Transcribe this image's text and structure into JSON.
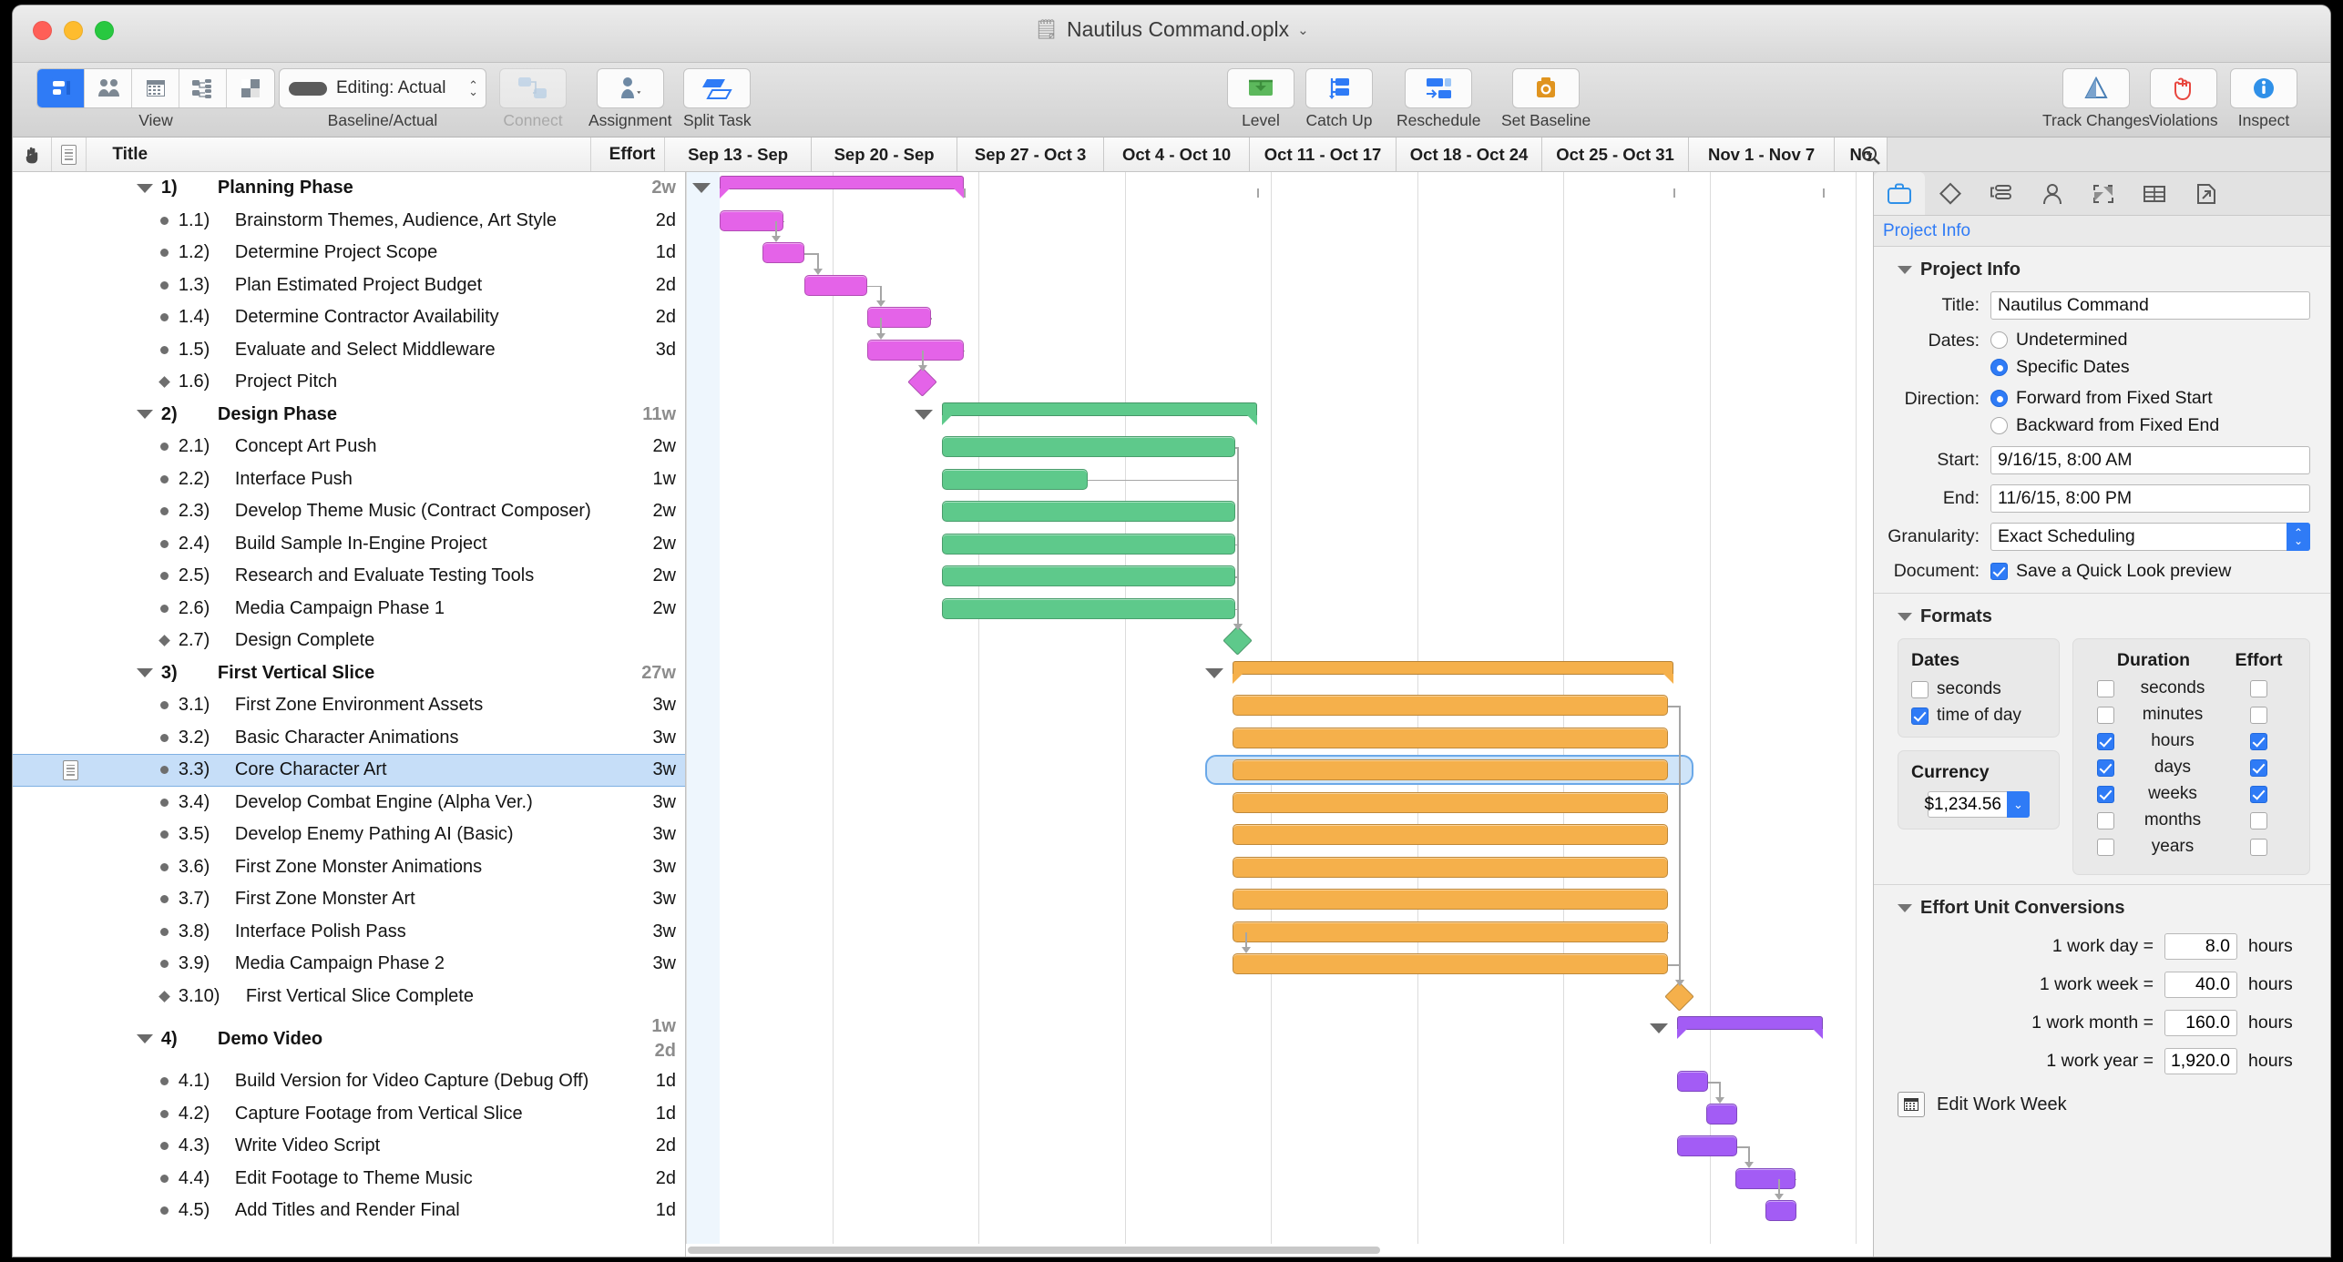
{
  "window": {
    "title": "Nautilus Command.oplx",
    "doc_icon": "document-icon",
    "chevron": "⌄"
  },
  "toolbar": {
    "groups": [
      {
        "label": "View",
        "name": "view"
      },
      {
        "label": "Baseline/Actual",
        "name": "baseline-actual"
      },
      {
        "label": "Connect",
        "name": "connect",
        "dim": true
      },
      {
        "label": "Assignment",
        "name": "assignment"
      },
      {
        "label": "Split Task",
        "name": "split-task"
      },
      {
        "label": "Level",
        "name": "level"
      },
      {
        "label": "Catch Up",
        "name": "catch-up"
      },
      {
        "label": "Reschedule",
        "name": "reschedule"
      },
      {
        "label": "Set Baseline",
        "name": "set-baseline"
      },
      {
        "label": "Track Changes",
        "name": "track-changes"
      },
      {
        "label": "Violations",
        "name": "violations"
      },
      {
        "label": "Inspect",
        "name": "inspect"
      }
    ],
    "baseline_value": "Editing: Actual"
  },
  "outline": {
    "columns": {
      "title": "Title",
      "effort": "Effort",
      "extra": "2"
    },
    "rows": [
      {
        "kind": "group",
        "num": "1)",
        "title": "Planning Phase",
        "effort": "2w"
      },
      {
        "kind": "task",
        "num": "1.1)",
        "title": "Brainstorm Themes, Audience, Art Style",
        "effort": "2d"
      },
      {
        "kind": "task",
        "num": "1.2)",
        "title": "Determine Project Scope",
        "effort": "1d"
      },
      {
        "kind": "task",
        "num": "1.3)",
        "title": "Plan Estimated Project Budget",
        "effort": "2d"
      },
      {
        "kind": "task",
        "num": "1.4)",
        "title": "Determine Contractor Availability",
        "effort": "2d"
      },
      {
        "kind": "task",
        "num": "1.5)",
        "title": "Evaluate and Select Middleware",
        "effort": "3d"
      },
      {
        "kind": "milestone",
        "num": "1.6)",
        "title": "Project Pitch",
        "effort": ""
      },
      {
        "kind": "group",
        "num": "2)",
        "title": "Design Phase",
        "effort": "11w"
      },
      {
        "kind": "task",
        "num": "2.1)",
        "title": "Concept Art Push",
        "effort": "2w"
      },
      {
        "kind": "task",
        "num": "2.2)",
        "title": "Interface Push",
        "effort": "1w"
      },
      {
        "kind": "task",
        "num": "2.3)",
        "title": "Develop Theme Music (Contract Composer)",
        "effort": "2w"
      },
      {
        "kind": "task",
        "num": "2.4)",
        "title": "Build Sample In-Engine Project",
        "effort": "2w"
      },
      {
        "kind": "task",
        "num": "2.5)",
        "title": "Research and Evaluate Testing Tools",
        "effort": "2w"
      },
      {
        "kind": "task",
        "num": "2.6)",
        "title": "Media Campaign Phase 1",
        "effort": "2w"
      },
      {
        "kind": "milestone",
        "num": "2.7)",
        "title": "Design Complete",
        "effort": ""
      },
      {
        "kind": "group",
        "num": "3)",
        "title": "First Vertical Slice",
        "effort": "27w"
      },
      {
        "kind": "task",
        "num": "3.1)",
        "title": "First Zone Environment Assets",
        "effort": "3w"
      },
      {
        "kind": "task",
        "num": "3.2)",
        "title": "Basic Character Animations",
        "effort": "3w"
      },
      {
        "kind": "task",
        "num": "3.3)",
        "title": "Core Character Art",
        "effort": "3w",
        "selected": true,
        "note": true
      },
      {
        "kind": "task",
        "num": "3.4)",
        "title": "Develop Combat Engine (Alpha Ver.)",
        "effort": "3w"
      },
      {
        "kind": "task",
        "num": "3.5)",
        "title": "Develop Enemy Pathing AI (Basic)",
        "effort": "3w"
      },
      {
        "kind": "task",
        "num": "3.6)",
        "title": "First Zone Monster Animations",
        "effort": "3w"
      },
      {
        "kind": "task",
        "num": "3.7)",
        "title": "First Zone Monster Art",
        "effort": "3w"
      },
      {
        "kind": "task",
        "num": "3.8)",
        "title": "Interface Polish Pass",
        "effort": "3w"
      },
      {
        "kind": "task",
        "num": "3.9)",
        "title": "Media Campaign Phase 2",
        "effort": "3w"
      },
      {
        "kind": "milestone",
        "num": "3.10)",
        "title": "First Vertical Slice Complete",
        "effort": "",
        "wide": true
      },
      {
        "kind": "group",
        "num": "4)",
        "title": "Demo Video",
        "effort": "1w",
        "effort2": "2d"
      },
      {
        "kind": "task",
        "num": "4.1)",
        "title": "Build Version for Video Capture (Debug Off)",
        "effort": "1d"
      },
      {
        "kind": "task",
        "num": "4.2)",
        "title": "Capture Footage from Vertical Slice",
        "effort": "1d"
      },
      {
        "kind": "task",
        "num": "4.3)",
        "title": "Write Video Script",
        "effort": "2d"
      },
      {
        "kind": "task",
        "num": "4.4)",
        "title": "Edit Footage to Theme Music",
        "effort": "2d"
      },
      {
        "kind": "task",
        "num": "4.5)",
        "title": "Add Titles and Render Final",
        "effort": "1d"
      }
    ]
  },
  "gantt": {
    "date_columns": [
      "Sep 13 - Sep",
      "Sep 20 - Sep",
      "Sep 27 - Oct 3",
      "Oct 4 - Oct 10",
      "Oct 11 - Oct 17",
      "Oct 18 - Oct 24",
      "Oct 25 - Oct 31",
      "Nov 1 - Nov 7",
      "No"
    ],
    "search_icon": "search-icon",
    "colors": {
      "planning": "#e463e8",
      "design": "#5ec98b",
      "vertical_slice": "#f5b04b",
      "demo_video": "#a35cf5",
      "link": "#a6a6a6",
      "selection": "#6aa8e8"
    }
  },
  "inspector": {
    "tabs": [
      {
        "name": "project-info-tab",
        "icon": "briefcase-icon",
        "active": true
      },
      {
        "name": "task-tab",
        "icon": "diamond-icon"
      },
      {
        "name": "dependency-tab",
        "icon": "dependency-icon"
      },
      {
        "name": "resource-tab",
        "icon": "person-icon"
      },
      {
        "name": "style-tab",
        "icon": "checker-square-icon"
      },
      {
        "name": "table-tab",
        "icon": "table-icon"
      },
      {
        "name": "export-tab",
        "icon": "page-arrow-icon"
      }
    ],
    "subtitle": "Project Info",
    "project_info": {
      "heading": "Project Info",
      "title_label": "Title:",
      "title_value": "Nautilus Command",
      "dates_label": "Dates:",
      "dates_option_undetermined": "Undetermined",
      "dates_option_specific": "Specific Dates",
      "dates_selected": "Specific Dates",
      "direction_label": "Direction:",
      "direction_option_forward": "Forward from Fixed Start",
      "direction_option_backward": "Backward from Fixed End",
      "direction_selected": "Forward from Fixed Start",
      "start_label": "Start:",
      "start_value": "9/16/15, 8:00 AM",
      "end_label": "End:",
      "end_value": "11/6/15, 8:00 PM",
      "granularity_label": "Granularity:",
      "granularity_value": "Exact Scheduling",
      "document_label": "Document:",
      "document_checkbox": "Save a Quick Look preview",
      "document_checked": true
    },
    "formats": {
      "heading": "Formats",
      "dates_panel_title": "Dates",
      "dates_options": [
        {
          "label": "seconds",
          "checked": false
        },
        {
          "label": "time of day",
          "checked": true
        }
      ],
      "currency_panel_title": "Currency",
      "currency_value": "$1,234.56",
      "duration_header": "Duration",
      "effort_header": "Effort",
      "units": [
        {
          "label": "seconds",
          "duration": false,
          "effort": false
        },
        {
          "label": "minutes",
          "duration": false,
          "effort": false
        },
        {
          "label": "hours",
          "duration": true,
          "effort": true
        },
        {
          "label": "days",
          "duration": true,
          "effort": true
        },
        {
          "label": "weeks",
          "duration": true,
          "effort": true
        },
        {
          "label": "months",
          "duration": false,
          "effort": false
        },
        {
          "label": "years",
          "duration": false,
          "effort": false
        }
      ]
    },
    "conversions": {
      "heading": "Effort Unit Conversions",
      "rows": [
        {
          "label": "1 work day =",
          "value": "8.0",
          "unit": "hours"
        },
        {
          "label": "1 work week =",
          "value": "40.0",
          "unit": "hours"
        },
        {
          "label": "1 work month =",
          "value": "160.0",
          "unit": "hours"
        },
        {
          "label": "1 work year =",
          "value": "1,920.0",
          "unit": "hours"
        }
      ],
      "edit_work_week": "Edit Work Week",
      "edit_work_week_icon": "calendar-icon"
    }
  }
}
